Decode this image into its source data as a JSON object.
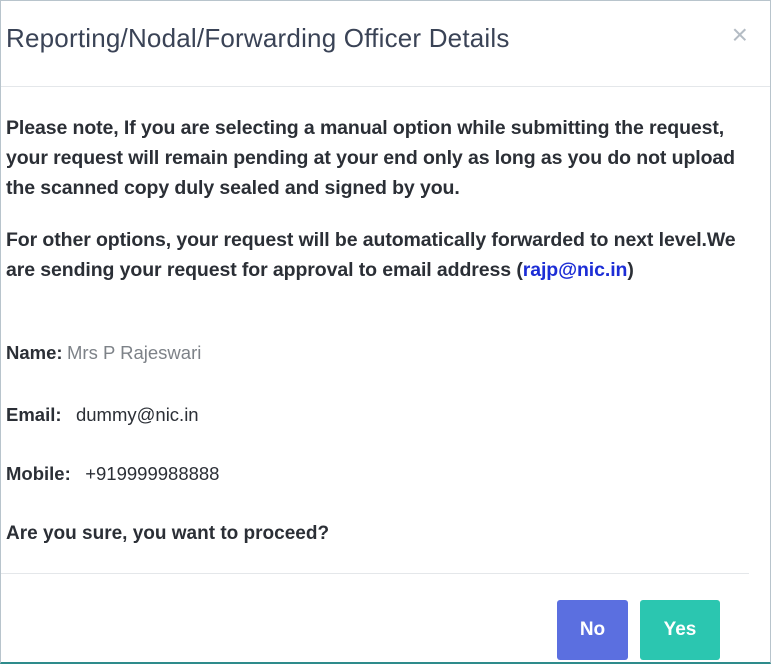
{
  "dialog": {
    "title": "Reporting/Nodal/Forwarding Officer Details",
    "close_symbol": "×",
    "note_1": "Please note, If you are selecting a manual option while submitting the request, your request will remain pending at your end only as long as you do not upload the scanned copy duly sealed and signed by you.",
    "note_2_prefix": "For other options, your request will be automatically forwarded to next level.We are sending your request for approval to email address (",
    "note_2_email": "rajp@nic.in",
    "note_2_suffix": ")",
    "fields": {
      "name_label": "Name:",
      "name_value": "Mrs P Rajeswari",
      "email_label": "Email:",
      "email_value": "dummy@nic.in",
      "mobile_label": "Mobile:",
      "mobile_value": "+919999988888"
    },
    "confirm_text": "Are you sure, you want to proceed?",
    "buttons": {
      "no_label": "No",
      "yes_label": "Yes"
    }
  },
  "colors": {
    "title_text": "#3a4356",
    "body_text": "#2b2f36",
    "link": "#1c2dd6",
    "no_button": "#5b6fe0",
    "yes_button": "#2bc6b0",
    "close_icon": "#b4bcc4"
  }
}
